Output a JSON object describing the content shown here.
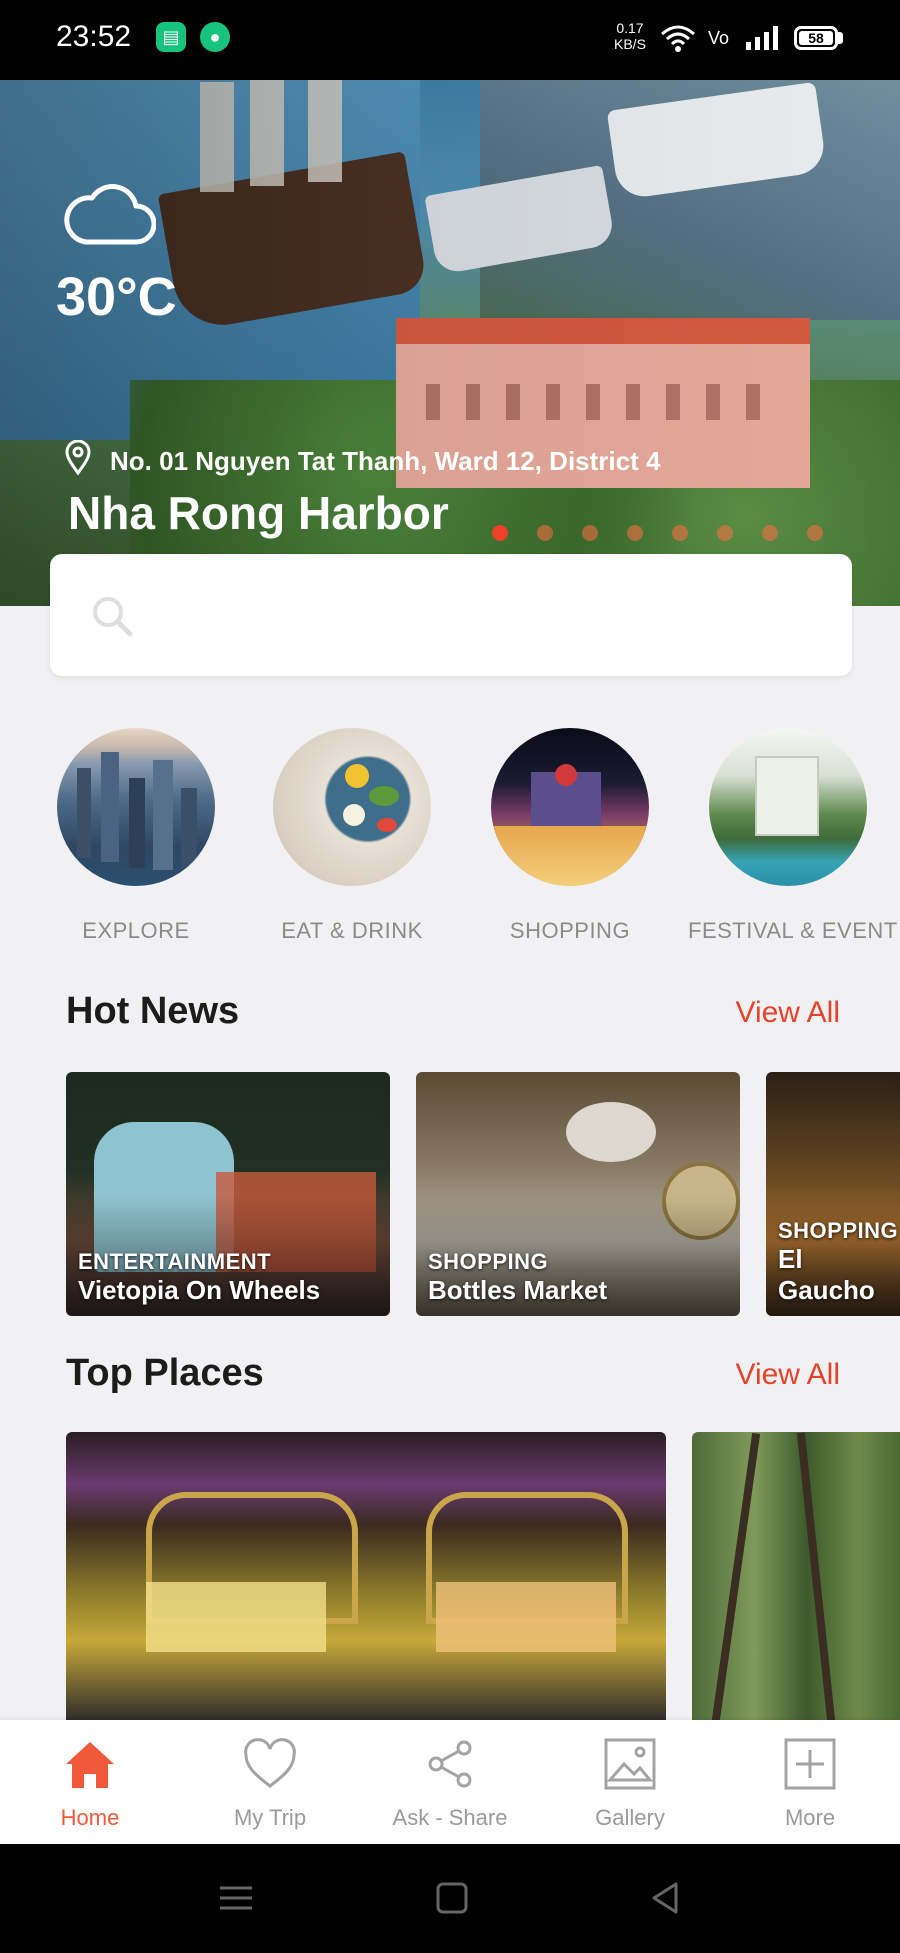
{
  "status_bar": {
    "time": "23:52",
    "net_speed_value": "0.17",
    "net_speed_unit": "KB/S",
    "battery": "58"
  },
  "hero": {
    "temperature": "30°C",
    "address": "No. 01 Nguyen Tat Thanh, Ward 12, District 4",
    "title": "Nha Rong Harbor",
    "carousel_count": 8,
    "carousel_active_index": 0
  },
  "search": {
    "placeholder": ""
  },
  "categories": [
    {
      "label": "EXPLORE"
    },
    {
      "label": "EAT & DRINK"
    },
    {
      "label": "SHOPPING"
    },
    {
      "label": "FESTIVAL & EVENT"
    }
  ],
  "hot_news": {
    "title": "Hot News",
    "view_all": "View All",
    "cards": [
      {
        "category": "ENTERTAINMENT",
        "name": "Vietopia On Wheels"
      },
      {
        "category": "SHOPPING",
        "name": "Bottles Market"
      },
      {
        "category": "SHOPPING",
        "name": "El Gaucho"
      }
    ]
  },
  "top_places": {
    "title": "Top Places",
    "view_all": "View All"
  },
  "bottom_nav": [
    {
      "label": "Home",
      "icon": "home-icon",
      "active": true
    },
    {
      "label": "My Trip",
      "icon": "heart-icon",
      "active": false
    },
    {
      "label": "Ask - Share",
      "icon": "share-icon",
      "active": false
    },
    {
      "label": "Gallery",
      "icon": "image-icon",
      "active": false
    },
    {
      "label": "More",
      "icon": "plus-square-icon",
      "active": false
    }
  ],
  "colors": {
    "accent": "#f05a3a",
    "view_all": "#e8432a",
    "background": "#f1f1f3"
  }
}
